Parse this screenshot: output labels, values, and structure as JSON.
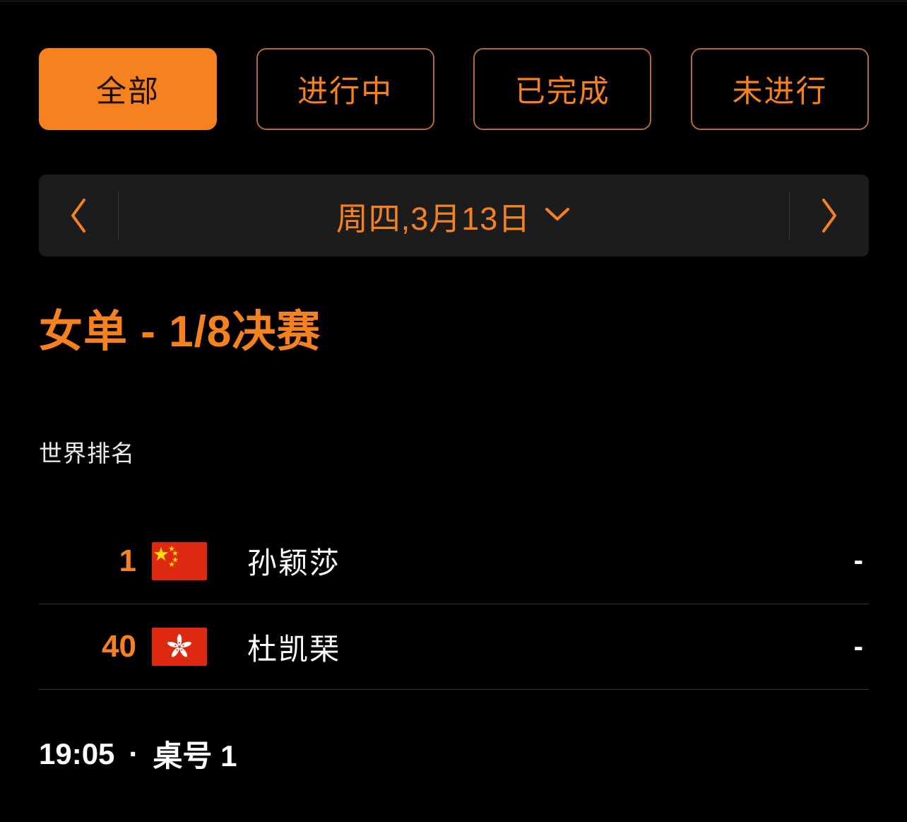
{
  "theme": {
    "background": "#000000",
    "accent": "#f5821f",
    "accent_border": "#b5673c",
    "surface": "#1c1c1c",
    "divider": "#343434",
    "text": "#ffffff"
  },
  "filters": {
    "items": [
      {
        "label": "全部",
        "active": true
      },
      {
        "label": "进行中",
        "active": false
      },
      {
        "label": "已完成",
        "active": false
      },
      {
        "label": "未进行",
        "active": false
      }
    ]
  },
  "date_nav": {
    "prev_icon": "chevron-left-icon",
    "next_icon": "chevron-right-icon",
    "dropdown_icon": "chevron-down-icon",
    "label": "周四,3月13日"
  },
  "event": {
    "title": "女单 - 1/8决赛",
    "ranking_caption": "世界排名"
  },
  "match": {
    "players": [
      {
        "rank": "1",
        "flag": "flag-china",
        "flag_label": "中国",
        "name": "孙颖莎",
        "score": "-"
      },
      {
        "rank": "40",
        "flag": "flag-hong-kong",
        "flag_label": "中国香港",
        "name": "杜凯琹",
        "score": "-"
      }
    ],
    "time": "19:05",
    "separator": "·",
    "table": "桌号 1"
  }
}
